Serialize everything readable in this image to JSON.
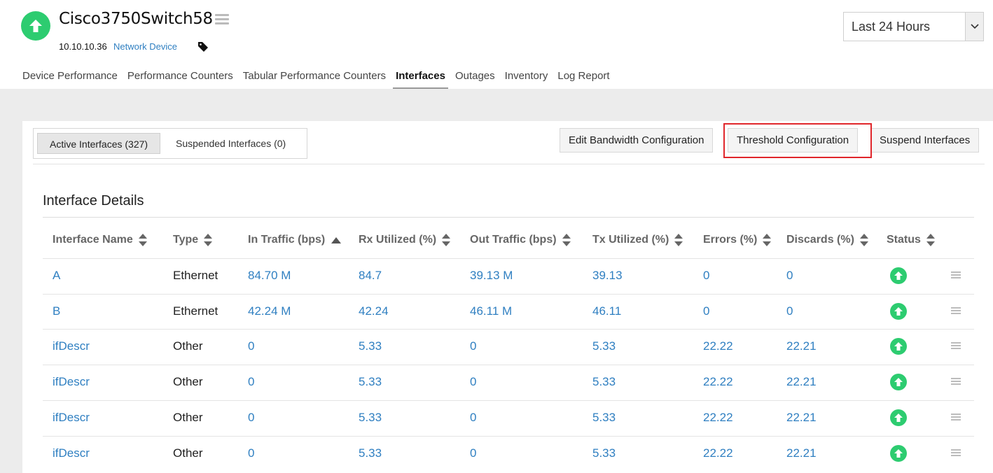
{
  "device": {
    "name": "Cisco3750Switch58",
    "ip": "10.10.10.36",
    "type": "Network Device",
    "status_icon": "up-arrow-icon",
    "status_color": "#2dcc70"
  },
  "time_range": {
    "selected": "Last 24 Hours"
  },
  "tabs": [
    {
      "label": "Device Performance"
    },
    {
      "label": "Performance Counters"
    },
    {
      "label": "Tabular Performance Counters"
    },
    {
      "label": "Interfaces",
      "active": true
    },
    {
      "label": "Outages"
    },
    {
      "label": "Inventory"
    },
    {
      "label": "Log Report"
    }
  ],
  "subtabs": {
    "active": "Active Interfaces (327)",
    "suspended": "Suspended Interfaces (0)"
  },
  "toolbar": {
    "edit_bandwidth": "Edit Bandwidth Configuration",
    "threshold": "Threshold Configuration",
    "suspend": "Suspend Interfaces",
    "highlight_color": "#e0262b"
  },
  "section_title": "Interface Details",
  "table": {
    "columns": [
      "Interface Name",
      "Type",
      "In Traffic (bps)",
      "Rx Utilized (%)",
      "Out Traffic (bps)",
      "Tx Utilized (%)",
      "Errors (%)",
      "Discards (%)",
      "Status"
    ],
    "sorted_column": "In Traffic (bps)",
    "sort_direction": "ascending",
    "rows": [
      {
        "name": "A",
        "type": "Ethernet",
        "in": "84.70 M",
        "rx": "84.7",
        "out": "39.13 M",
        "tx": "39.13",
        "errors": "0",
        "discards": "0",
        "status": "up"
      },
      {
        "name": "B",
        "type": "Ethernet",
        "in": "42.24 M",
        "rx": "42.24",
        "out": "46.11 M",
        "tx": "46.11",
        "errors": "0",
        "discards": "0",
        "status": "up"
      },
      {
        "name": "ifDescr",
        "type": "Other",
        "in": "0",
        "rx": "5.33",
        "out": "0",
        "tx": "5.33",
        "errors": "22.22",
        "discards": "22.21",
        "status": "up"
      },
      {
        "name": "ifDescr",
        "type": "Other",
        "in": "0",
        "rx": "5.33",
        "out": "0",
        "tx": "5.33",
        "errors": "22.22",
        "discards": "22.21",
        "status": "up"
      },
      {
        "name": "ifDescr",
        "type": "Other",
        "in": "0",
        "rx": "5.33",
        "out": "0",
        "tx": "5.33",
        "errors": "22.22",
        "discards": "22.21",
        "status": "up"
      },
      {
        "name": "ifDescr",
        "type": "Other",
        "in": "0",
        "rx": "5.33",
        "out": "0",
        "tx": "5.33",
        "errors": "22.22",
        "discards": "22.21",
        "status": "up"
      }
    ]
  },
  "colors": {
    "link": "#2f7fc1",
    "status_up": "#2dcc70",
    "page_background": "#ececec"
  }
}
